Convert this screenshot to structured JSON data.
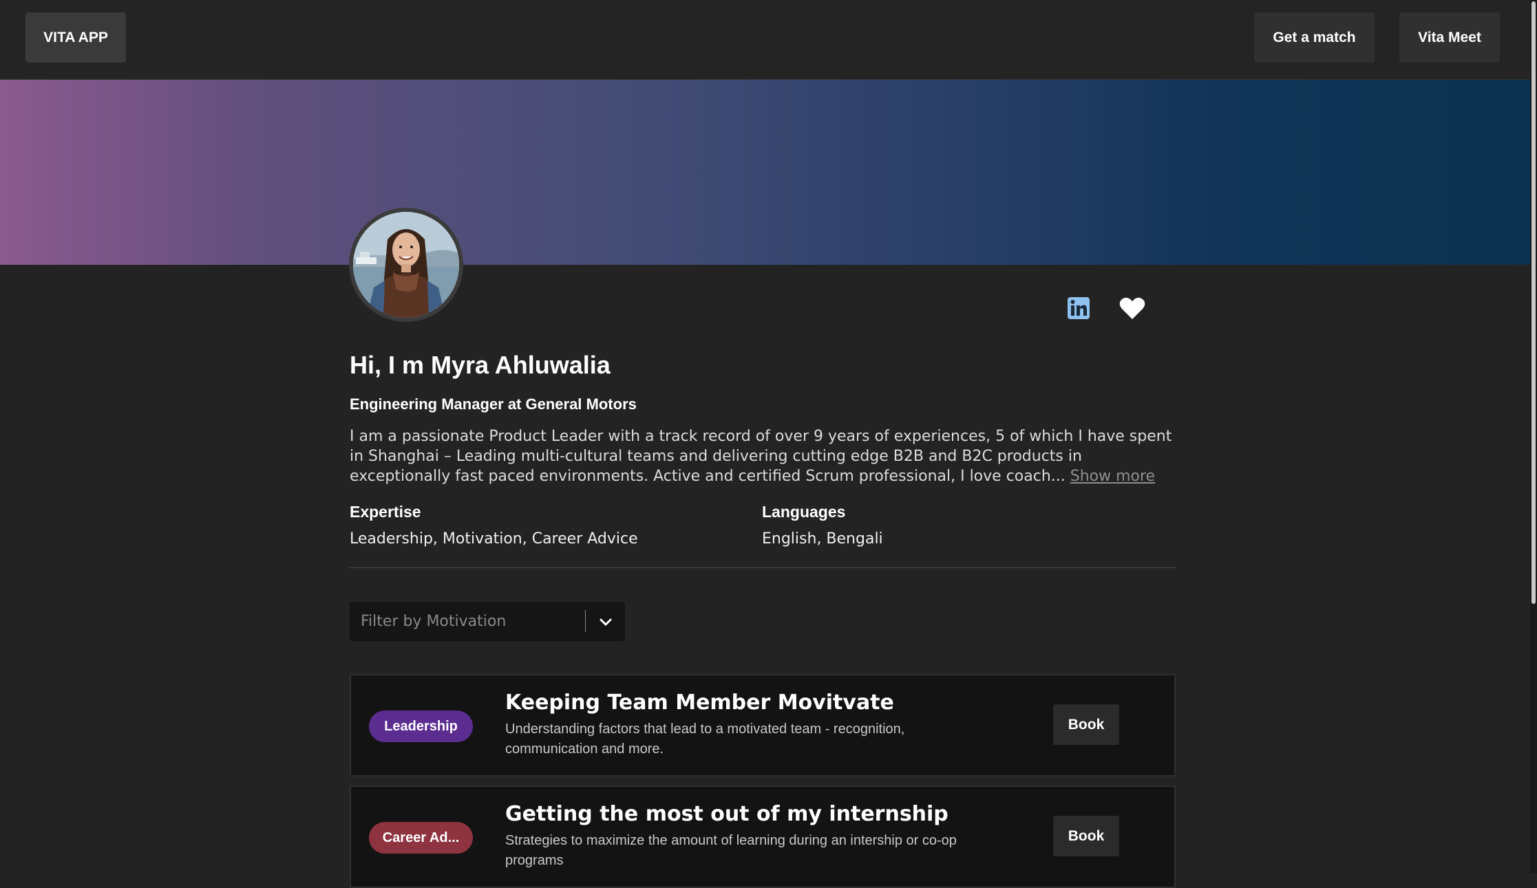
{
  "nav": {
    "brand": "VITA APP",
    "get_match": "Get a match",
    "vita_meet": "Vita Meet"
  },
  "profile": {
    "greeting": "Hi, I m Myra Ahluwalia",
    "title": "Engineering Manager at General Motors",
    "bio": "I am a passionate Product Leader with a track record of over 9 years of experiences, 5 of which I have spent in Shanghai – Leading multi-cultural teams and delivering cutting edge B2B and B2C products in exceptionally fast paced environments. Active and certified Scrum professional, I love coach...",
    "show_more": "Show more",
    "expertise_label": "Expertise",
    "expertise_value": "Leadership, Motivation, Career Advice",
    "languages_label": "Languages",
    "languages_value": "English, Bengali",
    "icons": {
      "linkedin": "linkedin-icon",
      "favorite": "heart-icon"
    }
  },
  "filter": {
    "placeholder": "Filter by Motivation",
    "icon": "chevron-down-icon"
  },
  "sessions": [
    {
      "tag": "Leadership",
      "tag_color": "#5c2d91",
      "title": "Keeping Team Member Movitvate",
      "description": "Understanding factors that lead to a motivated team - recognition, communication and more.",
      "button": "Book"
    },
    {
      "tag": "Career Ad...",
      "tag_color": "#8e3340",
      "title": "Getting the most out of my internship",
      "description": "Strategies to maximize the amount of learning during an intership or co-op programs",
      "button": "Book"
    }
  ],
  "colors": {
    "background": "#232323",
    "banner_start": "#8b5a8e",
    "banner_end": "#0b3250",
    "linkedin": "#8fc1ee"
  }
}
